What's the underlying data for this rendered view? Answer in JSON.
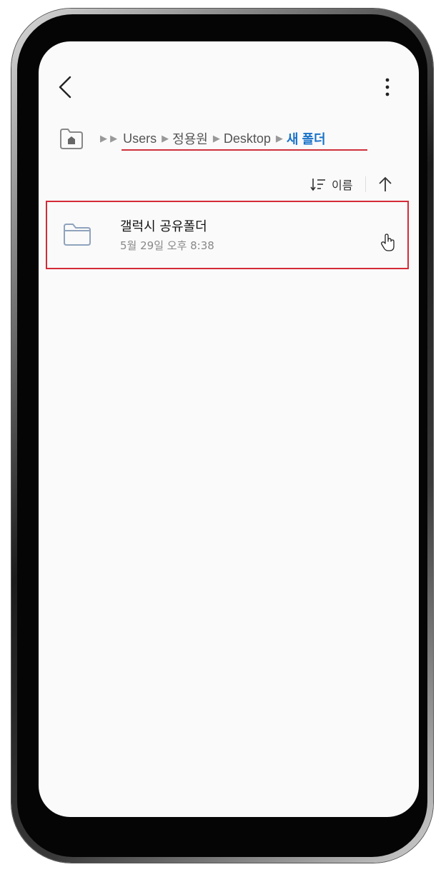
{
  "header": {
    "back_icon": "chevron-left-icon",
    "more_icon": "more-vertical-icon"
  },
  "breadcrumb": {
    "home_icon": "home-folder-icon",
    "items": [
      "Users",
      "정용원",
      "Desktop",
      "새 폴더"
    ],
    "current_color": "#1a73c9",
    "highlight_color": "#d52b36"
  },
  "sort": {
    "label": "이름",
    "order_icon": "arrow-up-icon"
  },
  "files": [
    {
      "name": "갤럭시 공유폴더",
      "date": "5월 29일 오후 8:38",
      "icon": "folder-icon"
    }
  ]
}
